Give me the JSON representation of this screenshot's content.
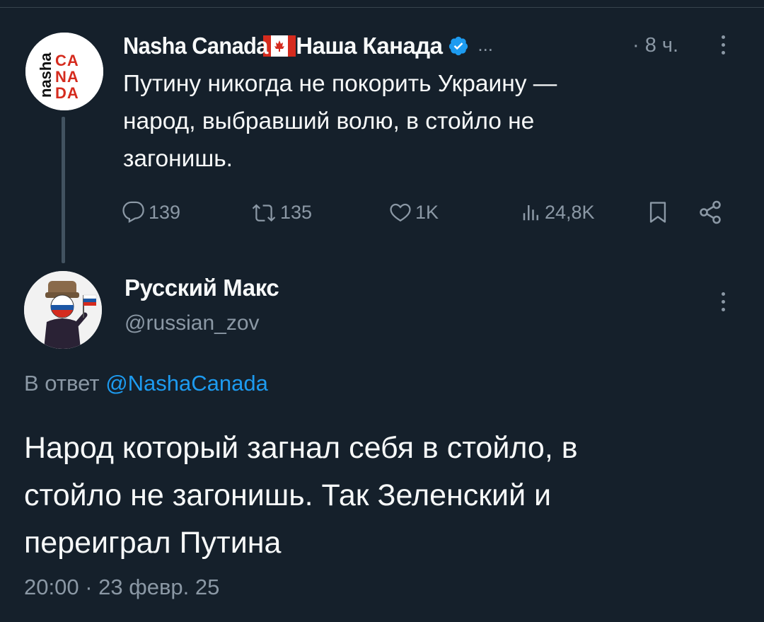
{
  "parent_tweet": {
    "author_name": "Nasha Canada",
    "author_name_ru": "Наша Канада",
    "avatar_lines": [
      "CA",
      "NA",
      "DA"
    ],
    "avatar_side_text": "nasha",
    "ellipsis": "...",
    "time_sep": "·",
    "time": "8 ч.",
    "text_lines": [
      "Путину никогда не покорить Украину —",
      "народ, выбравший волю, в стойло не",
      "загонишь."
    ],
    "stats": {
      "replies": "139",
      "retweets": "135",
      "likes": "1K",
      "views": "24,8K"
    }
  },
  "reply_tweet": {
    "author_name": "Русский Макс",
    "handle": "@russian_zov",
    "reply_to_prefix": "В ответ",
    "reply_to_mention": "@NashaCanada",
    "text_lines": [
      "Народ который загнал себя в стойло, в",
      "стойло не загонишь. Так Зеленский и",
      "переиграл Путина"
    ],
    "timestamp": "20:00 · 23 февр. 25"
  },
  "colors": {
    "background": "#15202b",
    "text_primary": "#f7f9f9",
    "text_secondary": "#8b98a5",
    "accent": "#1d9bf0",
    "canada_red": "#d52b1e",
    "thread_line": "#425260"
  },
  "icons": [
    "reply-icon",
    "retweet-icon",
    "like-icon",
    "views-icon",
    "bookmark-icon",
    "share-icon",
    "more-icon",
    "verified-icon",
    "canada-flag-icon"
  ]
}
